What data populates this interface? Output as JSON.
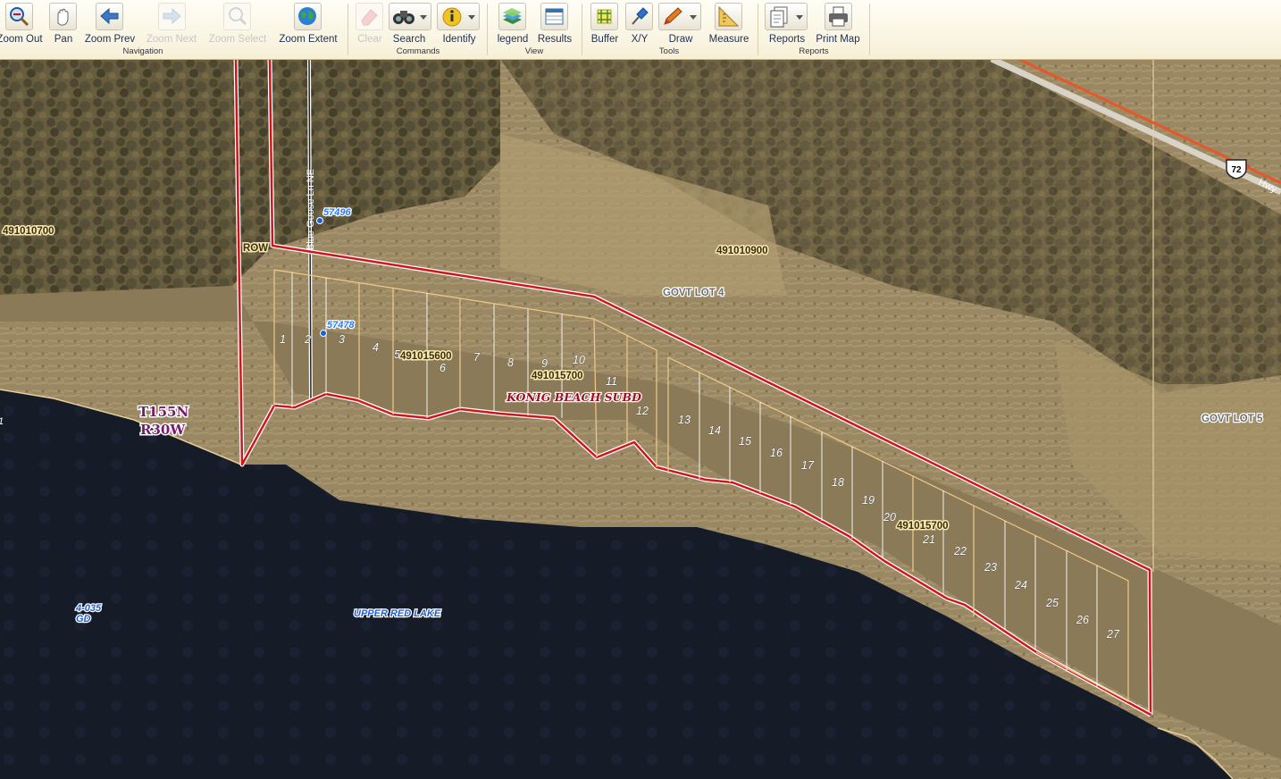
{
  "toolbar": {
    "tools": [
      {
        "id": "zoom-out",
        "label": "Zoom Out",
        "icon": "zoom-out-icon",
        "enabled": true
      },
      {
        "id": "pan",
        "label": "Pan",
        "icon": "hand-icon",
        "enabled": true
      },
      {
        "id": "zoom-prev",
        "label": "Zoom Prev",
        "icon": "arrow-left-icon",
        "enabled": true
      },
      {
        "id": "zoom-next",
        "label": "Zoom Next",
        "icon": "arrow-right-icon",
        "enabled": false
      },
      {
        "id": "zoom-select",
        "label": "Zoom Select",
        "icon": "zoom-select-icon",
        "enabled": false
      },
      {
        "id": "zoom-extent",
        "label": "Zoom Extent",
        "icon": "globe-icon",
        "enabled": true
      },
      {
        "id": "clear",
        "label": "Clear",
        "icon": "eraser-icon",
        "enabled": false
      },
      {
        "id": "search",
        "label": "Search",
        "icon": "binoculars-icon",
        "enabled": true
      },
      {
        "id": "identify",
        "label": "Identify",
        "icon": "info-icon",
        "enabled": true
      },
      {
        "id": "legend",
        "label": "legend",
        "icon": "layers-icon",
        "enabled": true
      },
      {
        "id": "results",
        "label": "Results",
        "icon": "table-icon",
        "enabled": true
      },
      {
        "id": "buffer",
        "label": "Buffer",
        "icon": "buffer-icon",
        "enabled": true
      },
      {
        "id": "xy",
        "label": "X/Y",
        "icon": "pushpin-icon",
        "enabled": true
      },
      {
        "id": "draw",
        "label": "Draw",
        "icon": "pencil-icon",
        "enabled": true
      },
      {
        "id": "measure",
        "label": "Measure",
        "icon": "ruler-icon",
        "enabled": true
      },
      {
        "id": "reports",
        "label": "Reports",
        "icon": "reports-icon",
        "enabled": true
      },
      {
        "id": "print-map",
        "label": "Print Map",
        "icon": "printer-icon",
        "enabled": true
      }
    ],
    "groups": {
      "navigation": "Navigation",
      "commands": "Commands",
      "view": "View",
      "tools": "Tools",
      "reports": "Reports"
    }
  },
  "map": {
    "parcel_ids": {
      "p1": "491010700",
      "p2": "491010900",
      "p3": "491015600",
      "p4": "491015700",
      "p5": "491015700"
    },
    "address_points": {
      "a1": "57496",
      "a2": "57478"
    },
    "road_name": "Blue Goose Ln NE",
    "highway_shield": "72",
    "highway_label": "Hwy",
    "row_label": "ROW",
    "govt_lot_4": "GOVT LOT 4",
    "govt_lot_5": "GOVT LOT 5",
    "township": "T155N",
    "range": "R30W",
    "subdivision": "KONIG BEACH SUBD",
    "lake_name": "UPPER RED LAKE",
    "lake_id_line1": "4-035",
    "lake_id_line2": "GD",
    "lot_numbers": [
      "1",
      "2",
      "3",
      "4",
      "5",
      "6",
      "7",
      "8",
      "9",
      "10",
      "11",
      "12",
      "13",
      "14",
      "15",
      "16",
      "17",
      "18",
      "19",
      "20",
      "21",
      "22",
      "23",
      "24",
      "25",
      "26",
      "27"
    ],
    "edge_label": "1",
    "colors": {
      "boundary_red": "#d0161b",
      "lot_line": "#f0c98a",
      "water": "#171d2a",
      "land": "#8b7b56"
    }
  }
}
